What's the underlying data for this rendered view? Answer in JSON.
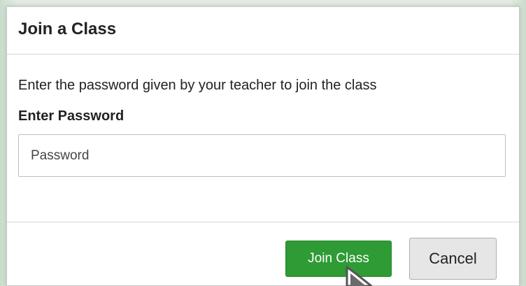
{
  "dialog": {
    "title": "Join a Class",
    "instructions": "Enter the password given by your teacher to join the class",
    "password_label": "Enter Password",
    "password_placeholder": "Password",
    "password_value": ""
  },
  "buttons": {
    "join_label": "Join Class",
    "cancel_label": "Cancel"
  },
  "colors": {
    "join_button": "#2e9b34",
    "cancel_button": "#e6e6e6",
    "backdrop": "#e2ebe2"
  },
  "icons": {
    "cursor": "mouse-pointer-icon"
  }
}
